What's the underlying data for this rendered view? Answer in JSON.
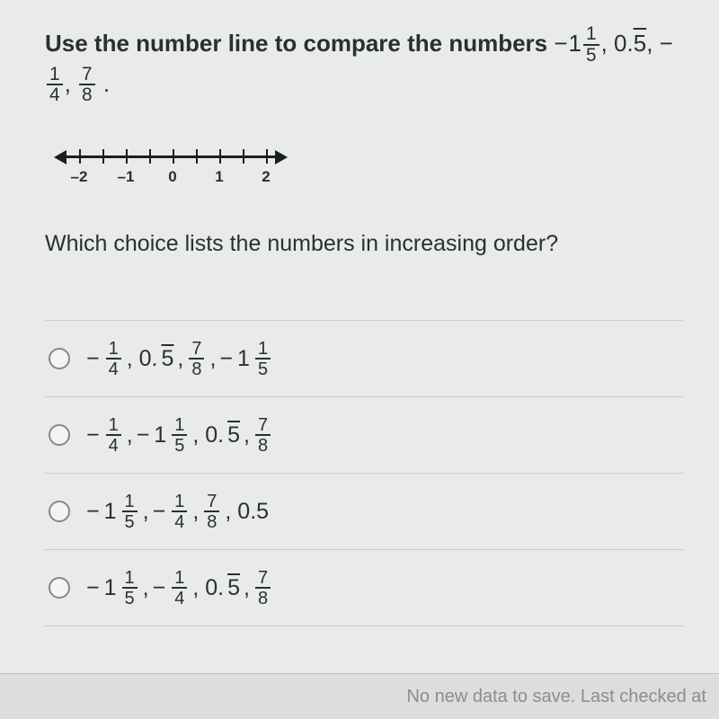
{
  "question_prefix": "Use the number line to compare the numbers ",
  "given_numbers_text": "−1 1/5, 0.5̅, −1/4, 7/8",
  "subquestion": "Which choice lists the numbers in increasing order?",
  "numberline": {
    "ticks": [
      -2,
      -1.5,
      -1,
      -0.5,
      0,
      0.5,
      1,
      1.5,
      2
    ],
    "labels": {
      "-2": "–2",
      "-1": "–1",
      "0": "0",
      "1": "1",
      "2": "2"
    }
  },
  "choices": [
    {
      "id": "a",
      "display": "−1/4, 0.5̅, 7/8, −1 1/5"
    },
    {
      "id": "b",
      "display": "−1/4, −1 1/5, 0.5̅, 7/8"
    },
    {
      "id": "c",
      "display": "−1 1/5, −1/4, 7/8, 0.5"
    },
    {
      "id": "d",
      "display": "−1 1/5, −1/4, 0.5̅, 7/8"
    }
  ],
  "footer_text": "No new data to save. Last checked at",
  "labels": {
    "neg2": "–2",
    "neg1": "–1",
    "zero": "0",
    "one": "1",
    "two": "2"
  }
}
